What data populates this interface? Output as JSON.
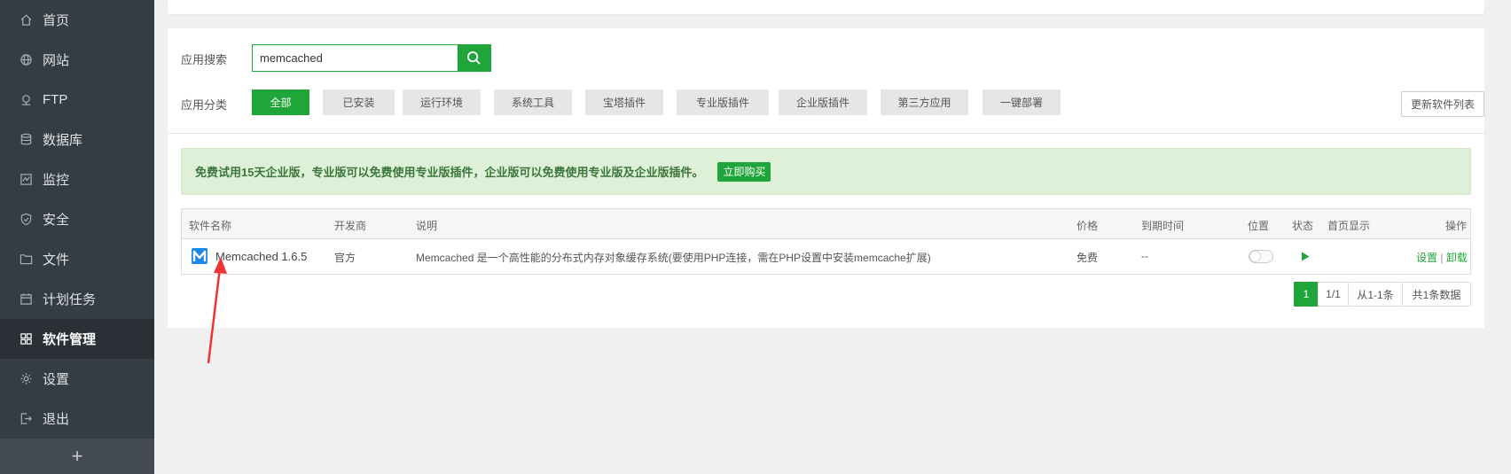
{
  "sidebar": {
    "items": [
      {
        "label": "首页",
        "icon": "home-icon"
      },
      {
        "label": "网站",
        "icon": "globe-icon"
      },
      {
        "label": "FTP",
        "icon": "ftp-icon"
      },
      {
        "label": "数据库",
        "icon": "database-icon"
      },
      {
        "label": "监控",
        "icon": "monitor-icon"
      },
      {
        "label": "安全",
        "icon": "shield-icon"
      },
      {
        "label": "文件",
        "icon": "folder-icon"
      },
      {
        "label": "计划任务",
        "icon": "calendar-icon"
      },
      {
        "label": "软件管理",
        "icon": "grid-icon",
        "active": true
      },
      {
        "label": "设置",
        "icon": "gear-icon"
      },
      {
        "label": "退出",
        "icon": "logout-icon"
      }
    ],
    "add_label": "+"
  },
  "search": {
    "label": "应用搜索",
    "value": "memcached"
  },
  "category": {
    "label": "应用分类",
    "buttons": [
      "全部",
      "已安装",
      "运行环境",
      "系统工具",
      "宝塔插件",
      "专业版插件",
      "企业版插件",
      "第三方应用",
      "一键部署"
    ],
    "active": "全部",
    "refresh_label": "更新软件列表"
  },
  "alert": {
    "text": "免费试用15天企业版，专业版可以免费使用专业版插件，企业版可以免费使用专业版及企业版插件。",
    "button": "立即购买"
  },
  "table": {
    "headers": {
      "name": "软件名称",
      "developer": "开发商",
      "description": "说明",
      "price": "价格",
      "expire": "到期时间",
      "location": "位置",
      "status": "状态",
      "homepage": "首页显示",
      "action": "操作"
    },
    "rows": [
      {
        "name": "Memcached 1.6.5",
        "developer": "官方",
        "description": "Memcached 是一个高性能的分布式内存对象缓存系统(要使用PHP连接，需在PHP设置中安装memcache扩展)",
        "price": "免费",
        "expire": "--",
        "homepage_enabled": false,
        "actions": {
          "settings": "设置",
          "separator": "|",
          "uninstall": "卸载"
        }
      }
    ]
  },
  "pagination": {
    "current": "1",
    "pages": "1/1",
    "range": "从1-1条",
    "total": "共1条数据"
  },
  "colors": {
    "accent": "#20a53a",
    "sidebar_bg": "#353d44",
    "annotation_arrow": "#ee3333"
  }
}
